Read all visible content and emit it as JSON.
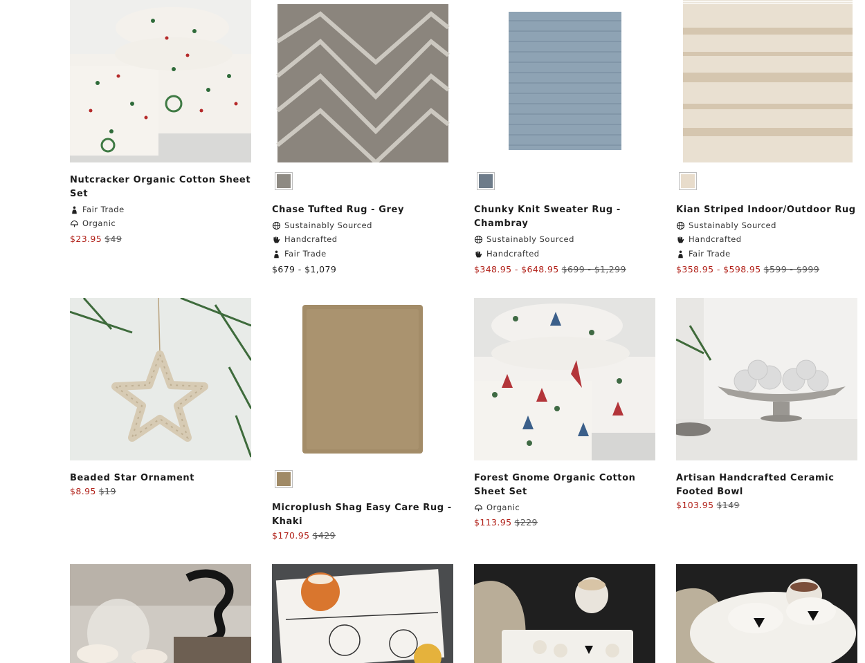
{
  "products": [
    {
      "name": "Nutcracker Organic Cotton Sheet Set",
      "attributes": [
        {
          "icon": "fair-trade-icon",
          "label": "Fair Trade"
        },
        {
          "icon": "organic-icon",
          "label": "Organic"
        }
      ],
      "sale_price": "$23.95",
      "original_price": "$49"
    },
    {
      "name": "Chase Tufted Rug - Grey",
      "swatch_color": "#8e8a83",
      "attributes": [
        {
          "icon": "globe-icon",
          "label": "Sustainably Sourced"
        },
        {
          "icon": "hand-icon",
          "label": "Handcrafted"
        },
        {
          "icon": "fair-trade-icon",
          "label": "Fair Trade"
        }
      ],
      "regular_price": "$679 - $1,079"
    },
    {
      "name": "Chunky Knit Sweater Rug - Chambray",
      "swatch_color": "#6e7c8a",
      "attributes": [
        {
          "icon": "globe-icon",
          "label": "Sustainably Sourced"
        },
        {
          "icon": "hand-icon",
          "label": "Handcrafted"
        }
      ],
      "sale_price": "$348.95 - $648.95",
      "original_price": "$699 - $1,299"
    },
    {
      "name": "Kian Striped Indoor/Outdoor Rug",
      "swatch_color": "#e8dccb",
      "attributes": [
        {
          "icon": "globe-icon",
          "label": "Sustainably Sourced"
        },
        {
          "icon": "hand-icon",
          "label": "Handcrafted"
        },
        {
          "icon": "fair-trade-icon",
          "label": "Fair Trade"
        }
      ],
      "sale_price": "$358.95 - $598.95",
      "original_price": "$599 - $999"
    },
    {
      "name": "Beaded Star Ornament",
      "attributes": [],
      "sale_price": "$8.95",
      "original_price": "$19"
    },
    {
      "name": "Microplush Shag Easy Care Rug - Khaki",
      "swatch_color": "#a08a66",
      "attributes": [],
      "sale_price": "$170.95",
      "original_price": "$429"
    },
    {
      "name": "Forest Gnome Organic Cotton Sheet Set",
      "attributes": [
        {
          "icon": "organic-icon",
          "label": "Organic"
        }
      ],
      "sale_price": "$113.95",
      "original_price": "$229"
    },
    {
      "name": "Artisan Handcrafted Ceramic Footed Bowl",
      "attributes": [],
      "sale_price": "$103.95",
      "original_price": "$149"
    }
  ],
  "colors": {
    "sale_red": "#b12018",
    "text_dark": "#1c1c1c",
    "swatch_border": "#bdbdbd"
  }
}
